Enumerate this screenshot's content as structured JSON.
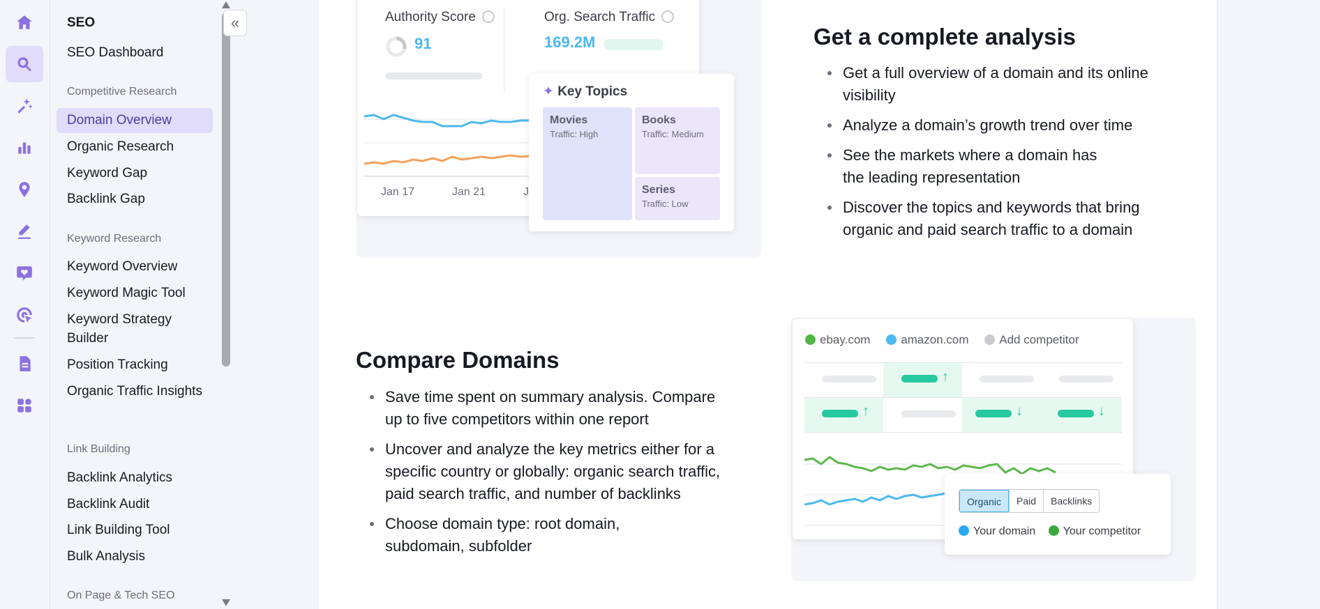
{
  "sidebar": {
    "title": "SEO",
    "dashboard": "SEO Dashboard",
    "sections": {
      "competitive": "Competitive Research",
      "keyword": "Keyword Research",
      "link": "Link Building",
      "onpage": "On Page & Tech SEO"
    },
    "competitive_items": [
      "Domain Overview",
      "Organic Research",
      "Keyword Gap",
      "Backlink Gap"
    ],
    "keyword_items": [
      "Keyword Overview",
      "Keyword Magic Tool",
      "Keyword Strategy Builder",
      "Position Tracking",
      "Organic Traffic Insights"
    ],
    "link_items": [
      "Backlink Analytics",
      "Backlink Audit",
      "Link Building Tool",
      "Bulk Analysis"
    ]
  },
  "rail": {
    "icons": [
      "home-icon",
      "seo-icon",
      "ai-sparkle-icon",
      "chart-icon",
      "location-pin-icon",
      "edit-icon",
      "heart-chat-icon",
      "target-icon",
      "document-icon",
      "apps-icon"
    ]
  },
  "analysis": {
    "authority_label": "Authority Score",
    "authority_value": "91",
    "traffic_label": "Org. Search Traffic",
    "traffic_value": "169.2M",
    "dates": [
      "Jan 17",
      "Jan 21",
      "J"
    ],
    "key_topics_title": "Key Topics",
    "topics": [
      {
        "name": "Movies",
        "traffic": "Traffic: High"
      },
      {
        "name": "Books",
        "traffic": "Traffic: Medium"
      },
      {
        "name": "Series",
        "traffic": "Traffic: Low"
      }
    ],
    "heading": "Get a complete analysis",
    "bullets": [
      "Get a full overview of a domain and its online visibility",
      "Analyze a domain’s growth trend over time",
      "See the markets where a domain has the leading representation",
      "Discover the topics and keywords that bring organic and paid search traffic to a domain"
    ]
  },
  "compare": {
    "heading": "Compare Domains",
    "bullets": [
      "Save time spent on summary analysis. Compare up to five competitors within one report",
      "Uncover and analyze the key metrics either for a specific country or globally: organic search traffic, paid search traffic, and number of backlinks",
      "Choose domain type: root domain, subdomain, subfolder"
    ],
    "legend": [
      {
        "label": "ebay.com",
        "color": "#52b447"
      },
      {
        "label": "amazon.com",
        "color": "#4cb8ef"
      },
      {
        "label": "Add competitor",
        "color": "#c8cad0"
      }
    ],
    "tabs": [
      "Organic",
      "Paid",
      "Backlinks"
    ],
    "selected_tab": "Organic",
    "domains_legend": [
      {
        "label": "Your domain",
        "color": "#2aa8f2"
      },
      {
        "label": "Your competitor",
        "color": "#3aa83a"
      }
    ]
  },
  "colors": {
    "accent": "#8c72e0",
    "active_bg": "#e1dcfa",
    "teal": "#27c9a0",
    "blue_value": "#4cb8ef"
  }
}
